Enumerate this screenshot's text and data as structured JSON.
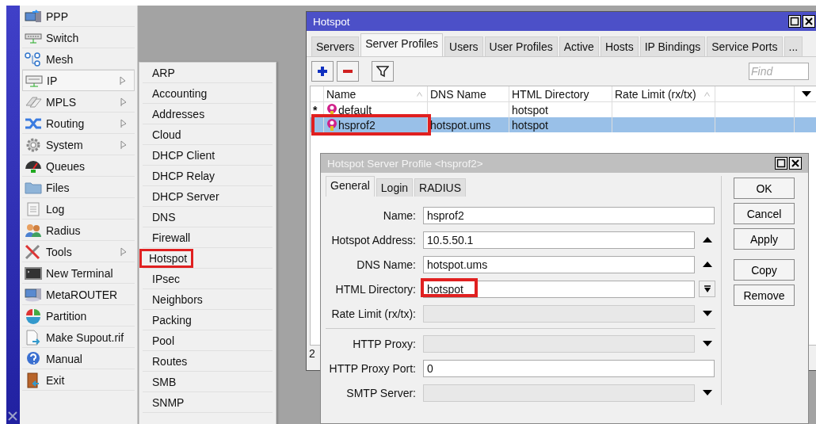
{
  "sidebar_menu": {
    "items": [
      {
        "label": "PPP",
        "has_submenu": false,
        "selected": false
      },
      {
        "label": "Switch",
        "has_submenu": false,
        "selected": false
      },
      {
        "label": "Mesh",
        "has_submenu": false,
        "selected": false
      },
      {
        "label": "IP",
        "has_submenu": true,
        "selected": true
      },
      {
        "label": "MPLS",
        "has_submenu": true,
        "selected": false
      },
      {
        "label": "Routing",
        "has_submenu": true,
        "selected": false
      },
      {
        "label": "System",
        "has_submenu": true,
        "selected": false
      },
      {
        "label": "Queues",
        "has_submenu": false,
        "selected": false
      },
      {
        "label": "Files",
        "has_submenu": false,
        "selected": false
      },
      {
        "label": "Log",
        "has_submenu": false,
        "selected": false
      },
      {
        "label": "Radius",
        "has_submenu": false,
        "selected": false
      },
      {
        "label": "Tools",
        "has_submenu": true,
        "selected": false
      },
      {
        "label": "New Terminal",
        "has_submenu": false,
        "selected": false
      },
      {
        "label": "MetaROUTER",
        "has_submenu": false,
        "selected": false
      },
      {
        "label": "Partition",
        "has_submenu": false,
        "selected": false
      },
      {
        "label": "Make Supout.rif",
        "has_submenu": false,
        "selected": false
      },
      {
        "label": "Manual",
        "has_submenu": false,
        "selected": false
      },
      {
        "label": "Exit",
        "has_submenu": false,
        "selected": false
      }
    ]
  },
  "ip_submenu": {
    "items": [
      {
        "label": "ARP",
        "highlighted": false
      },
      {
        "label": "Accounting",
        "highlighted": false
      },
      {
        "label": "Addresses",
        "highlighted": false
      },
      {
        "label": "Cloud",
        "highlighted": false
      },
      {
        "label": "DHCP Client",
        "highlighted": false
      },
      {
        "label": "DHCP Relay",
        "highlighted": false
      },
      {
        "label": "DHCP Server",
        "highlighted": false
      },
      {
        "label": "DNS",
        "highlighted": false
      },
      {
        "label": "Firewall",
        "highlighted": false
      },
      {
        "label": "Hotspot",
        "highlighted": true
      },
      {
        "label": "IPsec",
        "highlighted": false
      },
      {
        "label": "Neighbors",
        "highlighted": false
      },
      {
        "label": "Packing",
        "highlighted": false
      },
      {
        "label": "Pool",
        "highlighted": false
      },
      {
        "label": "Routes",
        "highlighted": false
      },
      {
        "label": "SMB",
        "highlighted": false
      },
      {
        "label": "SNMP",
        "highlighted": false
      }
    ]
  },
  "hotspot_window": {
    "title": "Hotspot",
    "tabs": [
      {
        "label": "Servers",
        "selected": false
      },
      {
        "label": "Server Profiles",
        "selected": true
      },
      {
        "label": "Users",
        "selected": false
      },
      {
        "label": "User Profiles",
        "selected": false
      },
      {
        "label": "Active",
        "selected": false
      },
      {
        "label": "Hosts",
        "selected": false
      },
      {
        "label": "IP Bindings",
        "selected": false
      },
      {
        "label": "Service Ports",
        "selected": false
      },
      {
        "label": "...",
        "selected": false
      }
    ],
    "find": {
      "placeholder": "Find"
    },
    "table": {
      "columns": [
        {
          "label": "Name",
          "sort_marker": true
        },
        {
          "label": "DNS Name",
          "sort_marker": false
        },
        {
          "label": "HTML Directory",
          "sort_marker": false
        },
        {
          "label": "Rate Limit (rx/tx)",
          "sort_marker": true
        }
      ],
      "rows": [
        {
          "flag": "*",
          "name": "default",
          "html_directory": "hotspot",
          "selected": false,
          "highlighted": false
        },
        {
          "name": "hsprof2",
          "dns_name": "hotspot.ums",
          "html_directory": "hotspot",
          "selected": true,
          "highlighted": true
        }
      ]
    },
    "status_text": "2"
  },
  "profile_dialog": {
    "title": "Hotspot Server Profile <hsprof2>",
    "tabs": [
      {
        "label": "General",
        "selected": true
      },
      {
        "label": "Login",
        "selected": false
      },
      {
        "label": "RADIUS",
        "selected": false
      }
    ],
    "field_groups": [
      [
        {
          "label": "Name:",
          "value": "hsprof2",
          "disabled": false,
          "kind": "plain",
          "highlighted": false
        },
        {
          "label": "Hotspot Address:",
          "value": "10.5.50.1",
          "disabled": false,
          "kind": "collapsible",
          "highlighted": false
        },
        {
          "label": "DNS Name:",
          "value": "hotspot.ums",
          "disabled": false,
          "kind": "collapsible",
          "highlighted": false
        },
        {
          "label": "HTML Directory:",
          "value": "hotspot",
          "disabled": false,
          "kind": "expandable",
          "highlighted": true
        },
        {
          "label": "Rate Limit (rx/tx):",
          "disabled": true,
          "kind": "dropdown",
          "highlighted": false
        }
      ],
      [
        {
          "label": "HTTP Proxy:",
          "disabled": true,
          "kind": "dropdown",
          "highlighted": false
        },
        {
          "label": "HTTP Proxy Port:",
          "value": "0",
          "disabled": false,
          "kind": "plain",
          "highlighted": false
        },
        {
          "label": "SMTP Server:",
          "disabled": true,
          "kind": "dropdown",
          "highlighted": false
        }
      ]
    ],
    "button_groups": [
      [
        "OK",
        "Cancel",
        "Apply"
      ],
      [
        "Copy",
        "Remove"
      ]
    ]
  }
}
